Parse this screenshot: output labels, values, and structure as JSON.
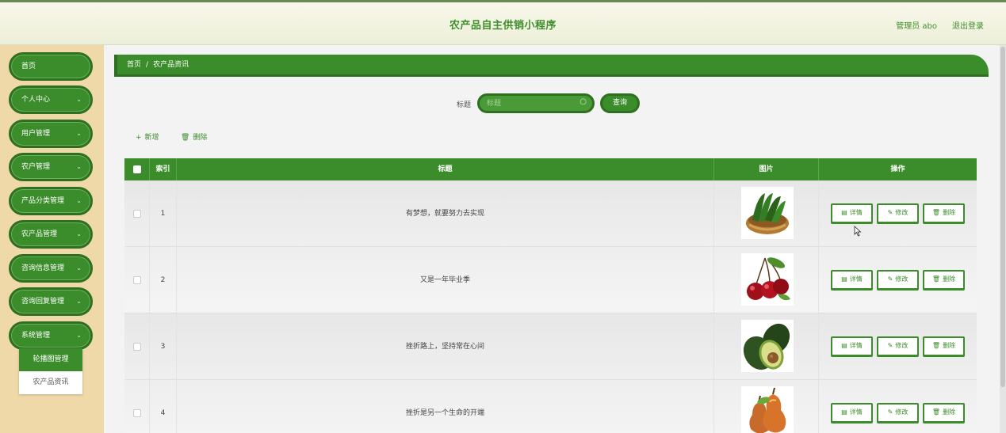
{
  "header": {
    "title": "农产品自主供销小程序",
    "admin_label": "管理员 abo",
    "logout_label": "退出登录"
  },
  "sidebar": {
    "items": [
      {
        "label": "首页",
        "has_chevron": false
      },
      {
        "label": "个人中心",
        "has_chevron": true
      },
      {
        "label": "用户管理",
        "has_chevron": true
      },
      {
        "label": "农户管理",
        "has_chevron": true
      },
      {
        "label": "产品分类管理",
        "has_chevron": true
      },
      {
        "label": "农产品管理",
        "has_chevron": true
      },
      {
        "label": "咨询信息管理",
        "has_chevron": true
      },
      {
        "label": "咨询回复管理",
        "has_chevron": true
      },
      {
        "label": "系统管理",
        "has_chevron": true
      }
    ],
    "submenu": [
      {
        "label": "轮播图管理",
        "active": true
      },
      {
        "label": "农产品资讯",
        "active": false
      }
    ]
  },
  "breadcrumb": {
    "home": "首页",
    "separator": "/",
    "current": "农产品资讯"
  },
  "search": {
    "label": "标题",
    "placeholder": "标题",
    "button_label": "查询"
  },
  "actions": {
    "add_label": "新增",
    "delete_label": "删除"
  },
  "table": {
    "columns": [
      "索引",
      "标题",
      "图片",
      "操作"
    ],
    "rows": [
      {
        "index": "1",
        "title": "有梦想，就要努力去实现",
        "image": "cucumber-basket"
      },
      {
        "index": "2",
        "title": "又是一年毕业季",
        "image": "cherries"
      },
      {
        "index": "3",
        "title": "挫折路上，坚持常在心间",
        "image": "avocado"
      },
      {
        "index": "4",
        "title": "挫折是另一个生命的开端",
        "image": "pears"
      }
    ],
    "row_buttons": {
      "detail": "详情",
      "edit": "修改",
      "delete": "删除"
    }
  },
  "colors": {
    "primary_green": "#3b8c2b",
    "dark_green": "#2f6f20",
    "sidebar_bg": "#efd9a8",
    "header_text": "#3f8e2c"
  }
}
